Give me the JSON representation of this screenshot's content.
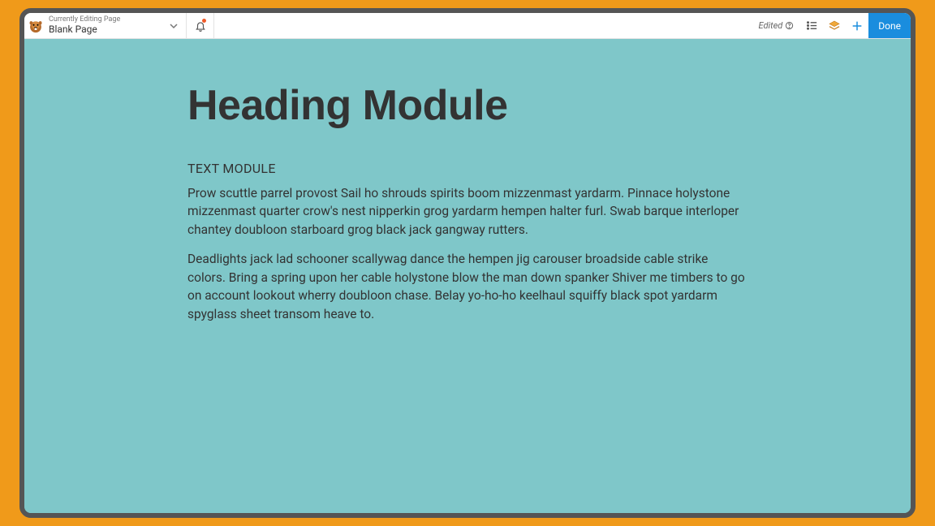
{
  "colors": {
    "accent": "#1a8dde",
    "frame": "#555",
    "bg_outer": "#f09a1a",
    "bg_canvas": "#7fc7c9",
    "notif_dot": "#f05a28"
  },
  "topbar": {
    "editing_label": "Currently Editing Page",
    "page_title": "Blank Page",
    "edited_label": "Edited",
    "done_label": "Done"
  },
  "content": {
    "heading": "Heading Module",
    "subheading": "TEXT MODULE",
    "para1": "Prow scuttle parrel provost Sail ho shrouds spirits boom mizzenmast yardarm. Pinnace holystone mizzenmast quarter crow's nest nipperkin grog yardarm hempen halter furl. Swab barque interloper chantey doubloon starboard grog black jack gangway rutters.",
    "para2": "Deadlights jack lad schooner scallywag dance the hempen jig carouser broadside cable strike colors. Bring a spring upon her cable holystone blow the man down spanker Shiver me timbers to go on account lookout wherry doubloon chase. Belay yo-ho-ho keelhaul squiffy black spot yardarm spyglass sheet transom heave to."
  }
}
